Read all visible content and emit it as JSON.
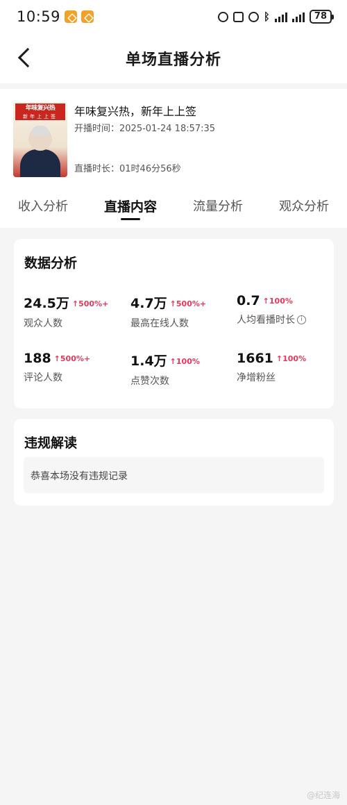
{
  "status_bar": {
    "time": "10:59",
    "battery": "78",
    "status_icons": [
      "nfc-icon",
      "alarm-icon",
      "bluetooth-icon",
      "signal-icon",
      "signal-icon"
    ]
  },
  "header": {
    "title": "单场直播分析"
  },
  "stream": {
    "cover_title": "年味复兴热",
    "cover_subtitle": "新年上上签",
    "title": "年味复兴热，新年上上签",
    "start_time": "开播时间：2025-01-24 18:57:35",
    "duration": "直播时长：01时46分56秒"
  },
  "tabs": [
    {
      "label": "收入分析",
      "active": false
    },
    {
      "label": "直播内容",
      "active": true
    },
    {
      "label": "流量分析",
      "active": false
    },
    {
      "label": "观众分析",
      "active": false
    }
  ],
  "data_analysis": {
    "heading": "数据分析",
    "metrics": [
      {
        "value": "24.5万",
        "change": "500%+",
        "label": "观众人数"
      },
      {
        "value": "4.7万",
        "change": "500%+",
        "label": "最高在线人数"
      },
      {
        "value": "0.7",
        "change": "100%",
        "label": "人均看播时长"
      },
      {
        "value": "188",
        "change": "500%+",
        "label": "评论人数"
      },
      {
        "value": "1.4万",
        "change": "100%",
        "label": "点赞次数"
      },
      {
        "value": "1661",
        "change": "100%",
        "label": "净增粉丝"
      }
    ]
  },
  "violation": {
    "heading": "违规解读",
    "message": "恭喜本场没有违规记录"
  },
  "watermark": "@纪连海",
  "colors": {
    "accent_change": "#e8365d",
    "background": "#f5f5f5",
    "card": "#ffffff"
  }
}
